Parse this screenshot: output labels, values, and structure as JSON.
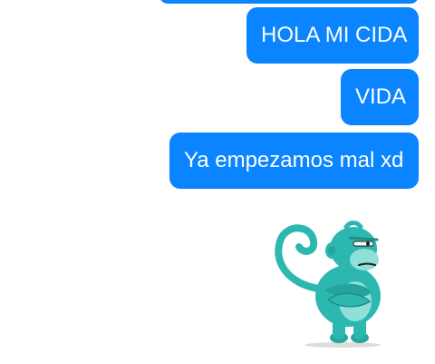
{
  "messages": [
    {
      "text": "HOLA MI CIDA"
    },
    {
      "text": "VIDA"
    },
    {
      "text": "Ya empezamos mal xd"
    }
  ],
  "sticker": {
    "icon": "monkey-sticker-icon",
    "color": "#2cb8b0"
  },
  "colors": {
    "bubble": "#0a84ff",
    "bubble_text": "#ffffff",
    "background": "#ffffff"
  }
}
